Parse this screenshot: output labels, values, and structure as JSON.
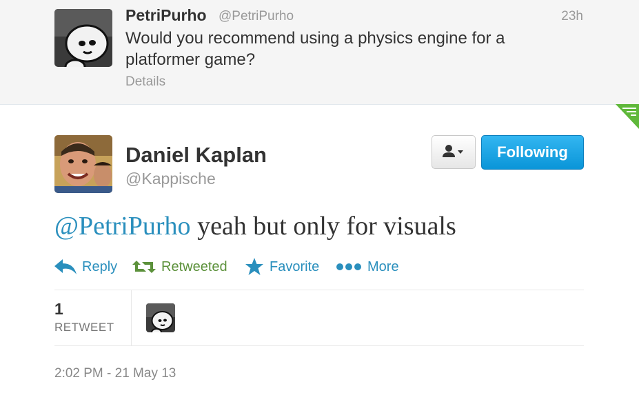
{
  "parent_tweet": {
    "name": "PetriPurho",
    "handle": "@PetriPurho",
    "time": "23h",
    "text": "Would you recommend using a physics engine for a platformer game?",
    "details_label": "Details"
  },
  "main_tweet": {
    "name": "Daniel Kaplan",
    "handle": "@Kappische",
    "follow_label": "Following",
    "mention": "@PetriPurho",
    "text": " yeah but only for visuals",
    "actions": {
      "reply": "Reply",
      "retweeted": "Retweeted",
      "favorite": "Favorite",
      "more": "More"
    },
    "stats": {
      "retweet_count": "1",
      "retweet_label": "RETWEET"
    },
    "timestamp": "2:02 PM - 21 May 13"
  },
  "colors": {
    "link": "#2a8fbd",
    "retweeted": "#5c913b",
    "follow_button": "#1fa7e6",
    "muted": "#999999"
  },
  "icons": [
    "reply-icon",
    "retweet-icon",
    "star-icon",
    "more-dots-icon",
    "user-icon",
    "caret-down-icon"
  ]
}
